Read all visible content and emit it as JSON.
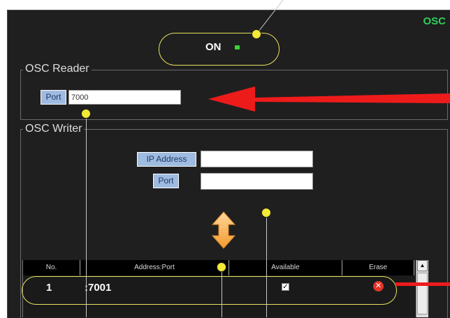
{
  "header": {
    "title": "OSC",
    "status": "ON"
  },
  "reader": {
    "title": "OSC Reader",
    "port_label": "Port",
    "port_value": "7000"
  },
  "writer": {
    "title": "OSC Writer",
    "ip_label": "IP Address",
    "ip_value": "",
    "port_label": "Port",
    "port_value": ""
  },
  "table": {
    "columns": [
      "No.",
      "Address:Port",
      "Available",
      "Erase"
    ],
    "rows": [
      {
        "no": "1",
        "address": ":7001",
        "available": true
      }
    ]
  },
  "colors": {
    "title_green": "#2ecf5c",
    "annotation_yellow": "#f3ea35",
    "arrow_red": "#ee1b1b",
    "label_blue": "#9fbbe0"
  },
  "icons": [
    "status-led-icon",
    "swap-arrow-icon",
    "erase-icon",
    "scroll-up-icon",
    "annotation-arrow-icon"
  ]
}
